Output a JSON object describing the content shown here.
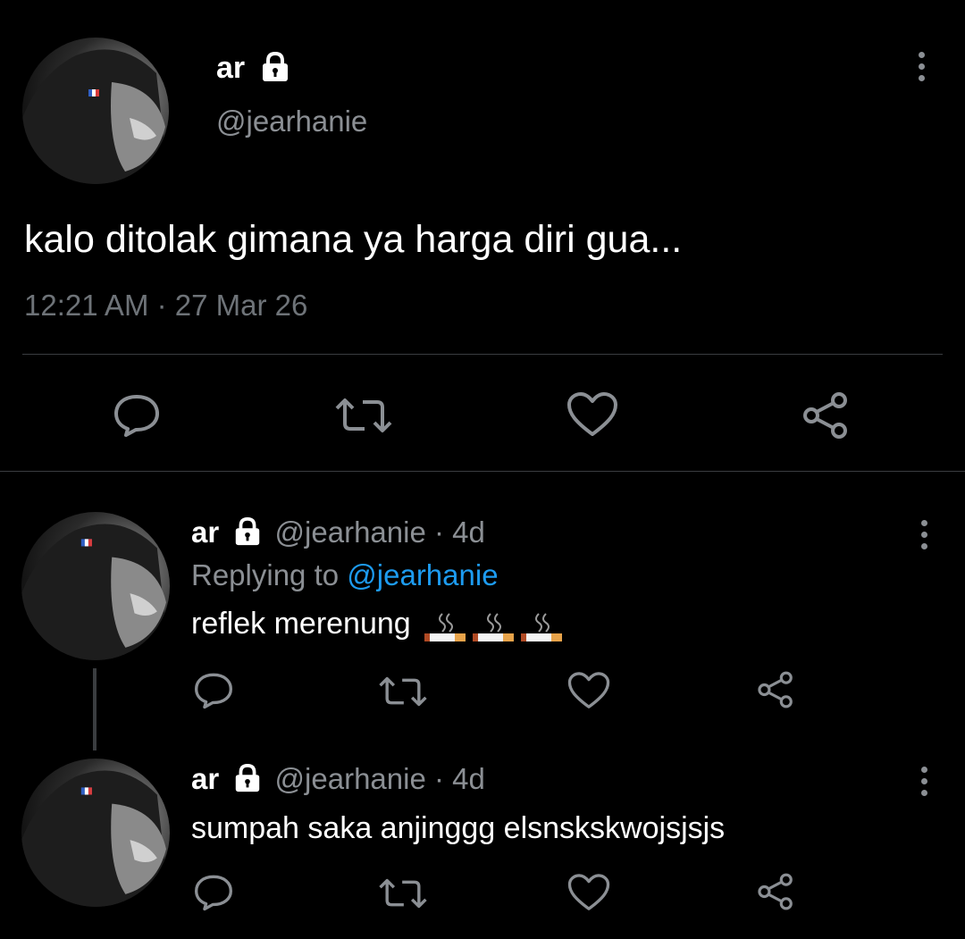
{
  "main_tweet": {
    "name": "ar",
    "handle": "@jearhanie",
    "text": "kalo ditolak gimana ya harga diri gua...",
    "time": "12:21 AM",
    "separator": "·",
    "date": "27 Mar 26"
  },
  "replies": [
    {
      "name": "ar",
      "handle": "@jearhanie",
      "age": "· 4d",
      "replying_prefix": "Replying to",
      "replying_to": "@jearhanie",
      "text": "reflek merenung",
      "emoji": "🚬🚬🚬"
    },
    {
      "name": "ar",
      "handle": "@jearhanie",
      "age": "· 4d",
      "text": "sumpah saka anjinggg elsnskskwojsjsjs"
    }
  ],
  "icons": {
    "reply": "reply-icon",
    "retweet": "retweet-icon",
    "like": "heart-icon",
    "share": "share-icon",
    "more": "more-vertical-icon",
    "lock": "lock-icon"
  },
  "colors": {
    "background": "#000000",
    "text": "#ffffff",
    "secondary": "#8b8f94",
    "link": "#1d9bf0",
    "divider": "#3a3d40"
  }
}
